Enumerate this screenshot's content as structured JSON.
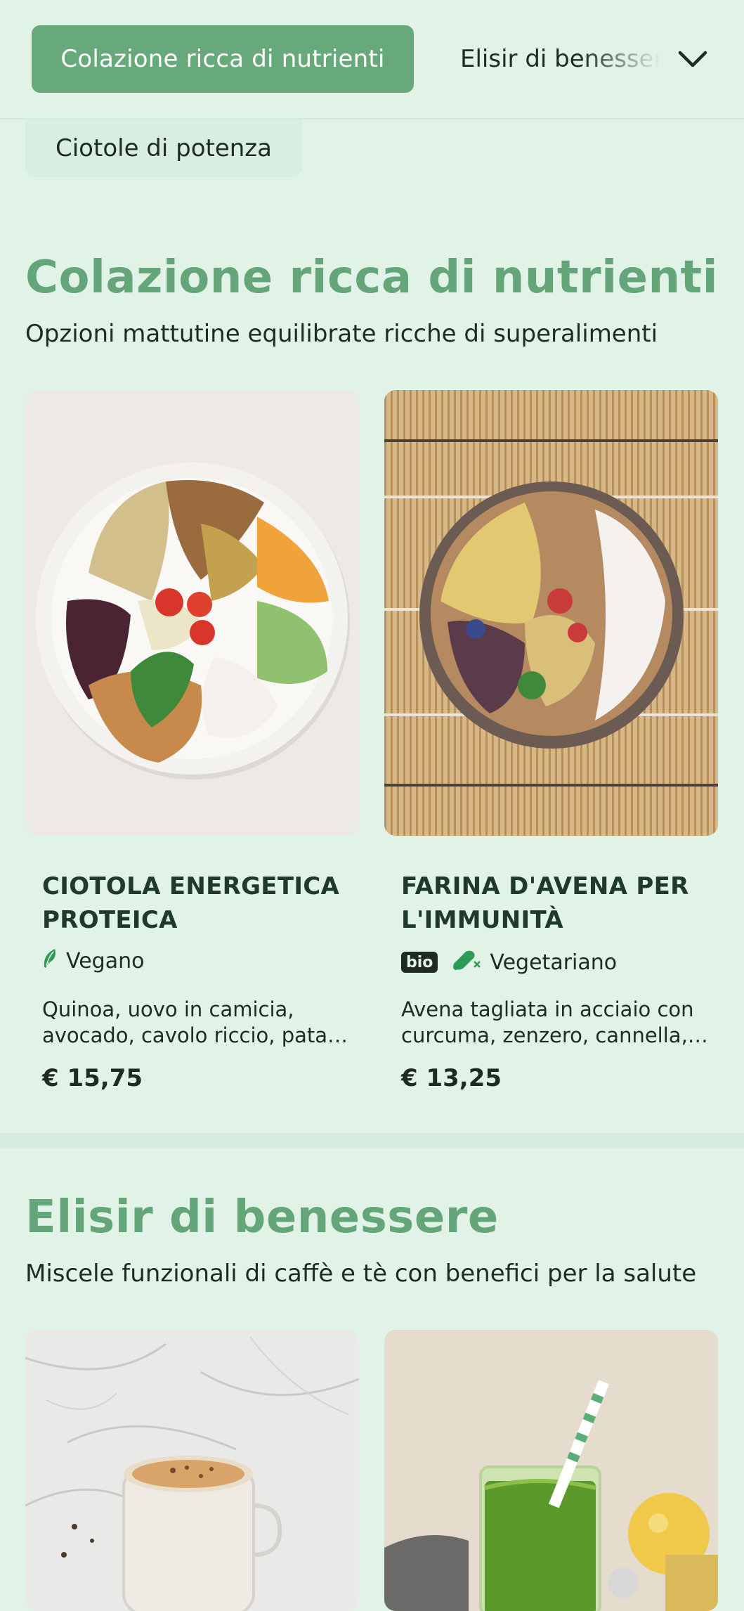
{
  "category_nav": {
    "active_label": "Colazione ricca di nutrienti",
    "next_label": "Elisir di benessere",
    "secondary_label": "Ciotole di potenza",
    "expand_icon": "chevron-down-icon"
  },
  "sections": [
    {
      "title": "Colazione ricca di nutrienti",
      "subtitle": "Opzioni mattutine equilibrate ricche di superalimenti",
      "items": [
        {
          "name": "CIOTOLA ENERGETICA PROTEICA",
          "badges": [],
          "diet_icon": "leaf-icon",
          "diet": "Vegano",
          "description": "Quinoa, uovo in camicia, avocado, cavolo riccio, patata dolce e semi misti",
          "price": "€ 15,75",
          "image": "protein-bowl-photo"
        },
        {
          "name": "FARINA D'AVENA PER L'IMMUNITÀ",
          "badges": [
            "bio"
          ],
          "diet_icon": "no-meat-icon",
          "diet": "Vegetariano",
          "description": "Avena tagliata in acciaio con curcuma, zenzero, cannella, frutti di bosco e semi",
          "price": "€ 13,25",
          "image": "oatmeal-bowl-photo"
        }
      ]
    },
    {
      "title": "Elisir di benessere",
      "subtitle": "Miscele funzionali di caffè e tè con benefici per la salute",
      "items": [
        {
          "image": "spiced-latte-photo"
        },
        {
          "image": "green-juice-photo"
        }
      ]
    }
  ],
  "colors": {
    "background": "#e1f3e7",
    "accent": "#68a97c",
    "title": "#65a57a",
    "text": "#1f2a24"
  }
}
